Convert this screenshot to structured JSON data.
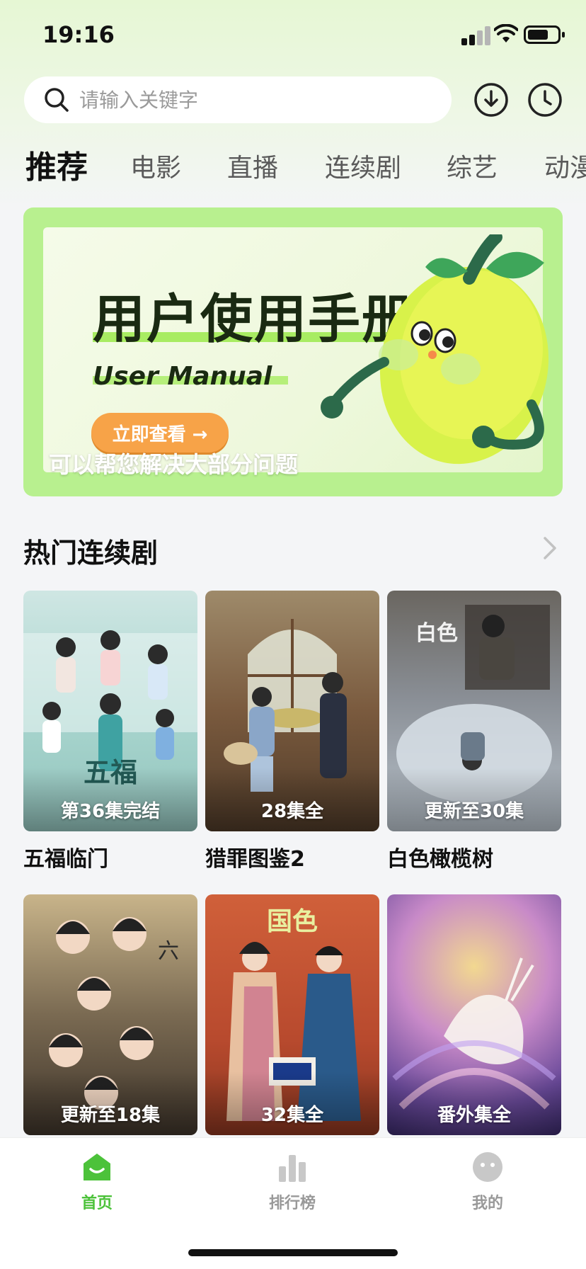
{
  "status_bar": {
    "time": "19:16"
  },
  "search": {
    "placeholder": "请输入关键字"
  },
  "header_icons": [
    "download-icon",
    "history-clock-icon"
  ],
  "tabs": [
    {
      "label": "推荐",
      "active": true
    },
    {
      "label": "电影"
    },
    {
      "label": "直播"
    },
    {
      "label": "连续剧"
    },
    {
      "label": "综艺"
    },
    {
      "label": "动漫"
    }
  ],
  "banner": {
    "title": "用户使用手册",
    "subtitle": "User Manual",
    "button_label": "立即查看 →",
    "caption": "可以帮您解决大部分问题"
  },
  "section": {
    "title": "热门连续剧"
  },
  "shows": [
    {
      "title": "五福临门",
      "badge": "第36集完结",
      "color": "#a9d6cf"
    },
    {
      "title": "猎罪图鉴2",
      "badge": "28集全",
      "color": "#7a5a3e"
    },
    {
      "title": "白色橄榄树",
      "badge": "更新至30集",
      "color": "#8a8f96"
    },
    {
      "title": "",
      "badge": "更新至18集",
      "color": "#5e5040"
    },
    {
      "title": "",
      "badge": "32集全",
      "color": "#b84a2e"
    },
    {
      "title": "",
      "badge": "番外集全",
      "color": "#6a4a9a"
    }
  ],
  "bottom_nav": [
    {
      "label": "首页",
      "icon": "home-icon",
      "active": true
    },
    {
      "label": "排行榜",
      "icon": "chart-bars-icon"
    },
    {
      "label": "我的",
      "icon": "profile-face-icon"
    }
  ],
  "colors": {
    "accent": "#4cc23a",
    "banner_green": "#b8f08f",
    "button_orange": "#f7a348"
  }
}
